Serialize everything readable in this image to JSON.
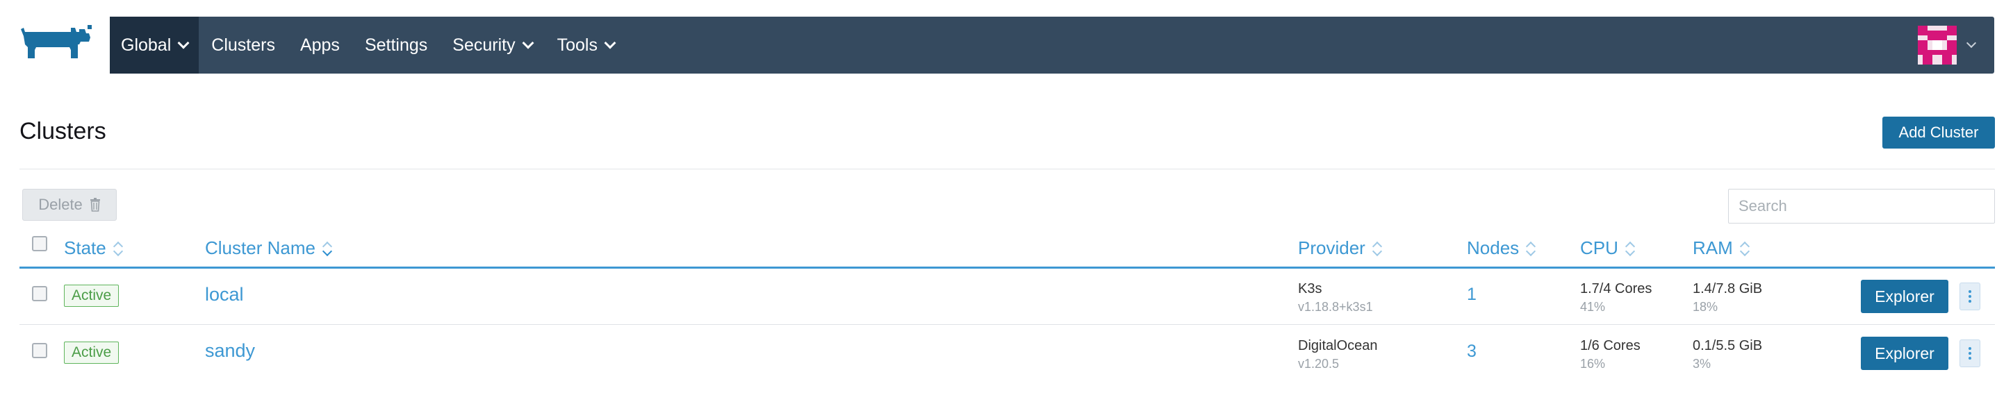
{
  "nav": {
    "items": [
      {
        "label": "Global",
        "dropdown": true,
        "active": true
      },
      {
        "label": "Clusters",
        "dropdown": false,
        "active": false
      },
      {
        "label": "Apps",
        "dropdown": false,
        "active": false
      },
      {
        "label": "Settings",
        "dropdown": false,
        "active": false
      },
      {
        "label": "Security",
        "dropdown": true,
        "active": false
      },
      {
        "label": "Tools",
        "dropdown": true,
        "active": false
      }
    ]
  },
  "page": {
    "title": "Clusters",
    "add_button": "Add Cluster",
    "delete_button": "Delete",
    "search_placeholder": "Search"
  },
  "table": {
    "headers": {
      "state": "State",
      "name": "Cluster Name",
      "provider": "Provider",
      "nodes": "Nodes",
      "cpu": "CPU",
      "ram": "RAM"
    },
    "rows": [
      {
        "state": "Active",
        "name": "local",
        "provider": "K3s",
        "version": "v1.18.8+k3s1",
        "nodes": "1",
        "cpu": "1.7/4 Cores",
        "cpu_pct": "41%",
        "ram": "1.4/7.8 GiB",
        "ram_pct": "18%",
        "action": "Explorer"
      },
      {
        "state": "Active",
        "name": "sandy",
        "provider": "DigitalOcean",
        "version": "v1.20.5",
        "nodes": "3",
        "cpu": "1/6 Cores",
        "cpu_pct": "16%",
        "ram": "0.1/5.5 GiB",
        "ram_pct": "3%",
        "action": "Explorer"
      }
    ]
  },
  "colors": {
    "nav_bg": "#354a5f",
    "nav_active": "#1e2f41",
    "primary_button": "#1a6fa1",
    "link": "#3d98d3",
    "active_badge": "#5fb55c",
    "avatar_accent": "#d6157a"
  },
  "icons": [
    "rancher-logo-icon",
    "trash-icon",
    "sort-icon",
    "kebab-menu-icon",
    "chevron-down-icon"
  ]
}
